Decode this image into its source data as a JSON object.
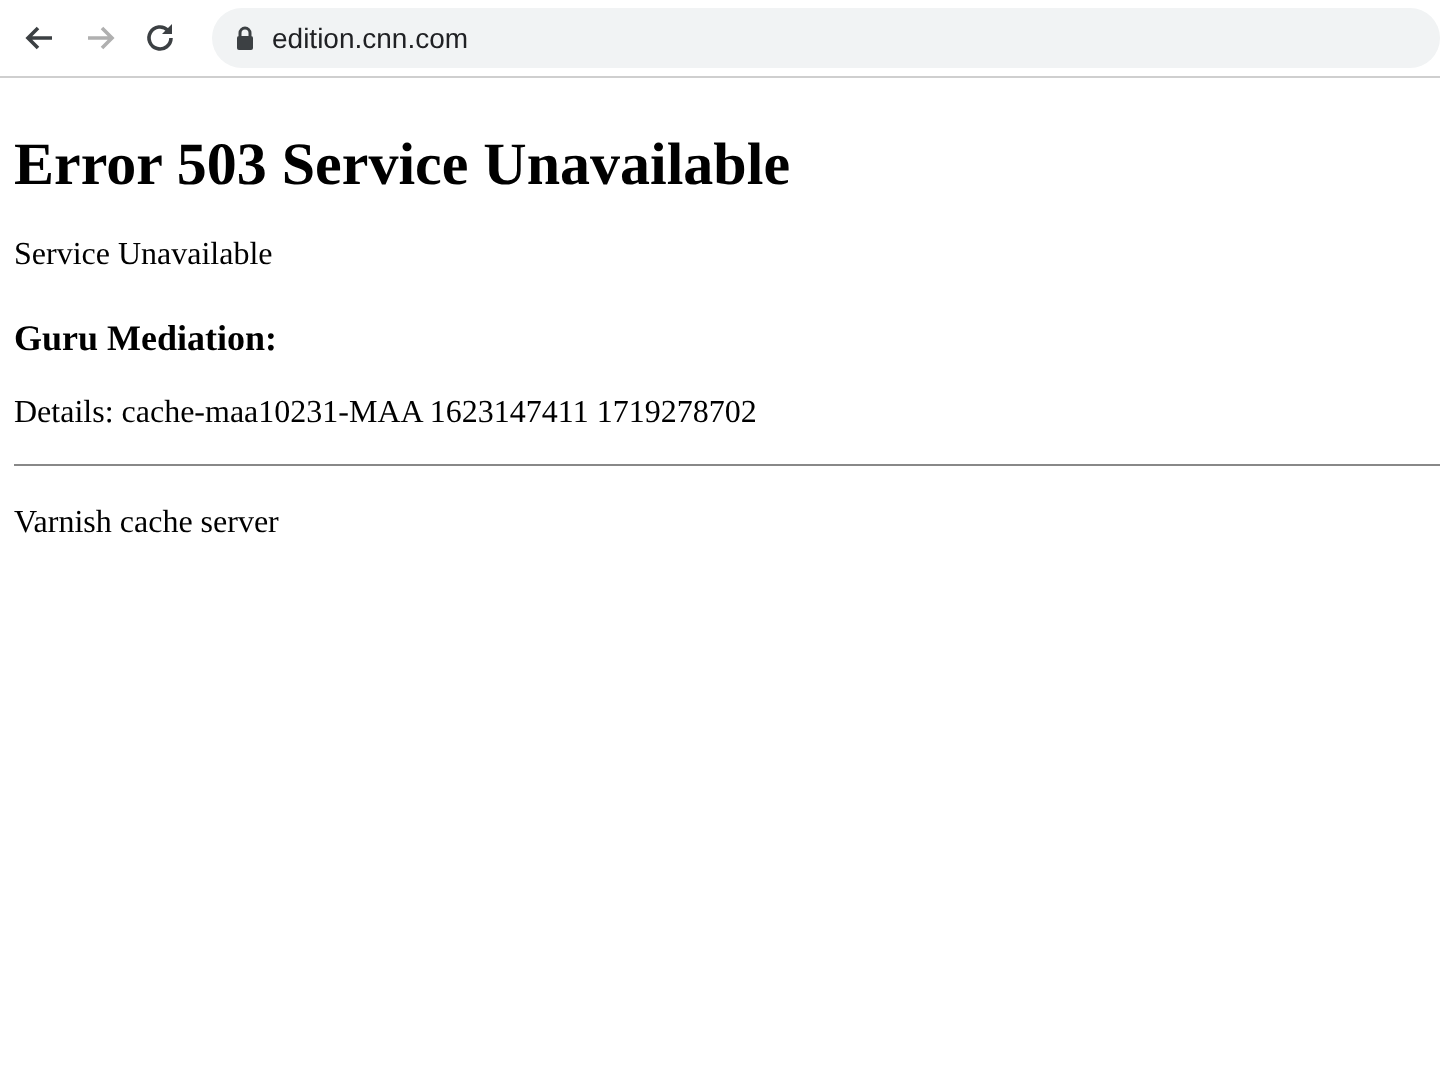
{
  "browser": {
    "nav_buttons": [
      {
        "kind": "back",
        "disabled": false
      },
      {
        "kind": "forward",
        "disabled": true
      },
      {
        "kind": "reload",
        "disabled": false
      }
    ],
    "address": "edition.cnn.com"
  },
  "page": {
    "heading": "Error 503 Service Unavailable",
    "message": "Service Unavailable",
    "subheading": "Guru Mediation:",
    "details": "Details: cache-maa10231-MAA 1623147411 1719278702",
    "footer": "Varnish cache server"
  }
}
